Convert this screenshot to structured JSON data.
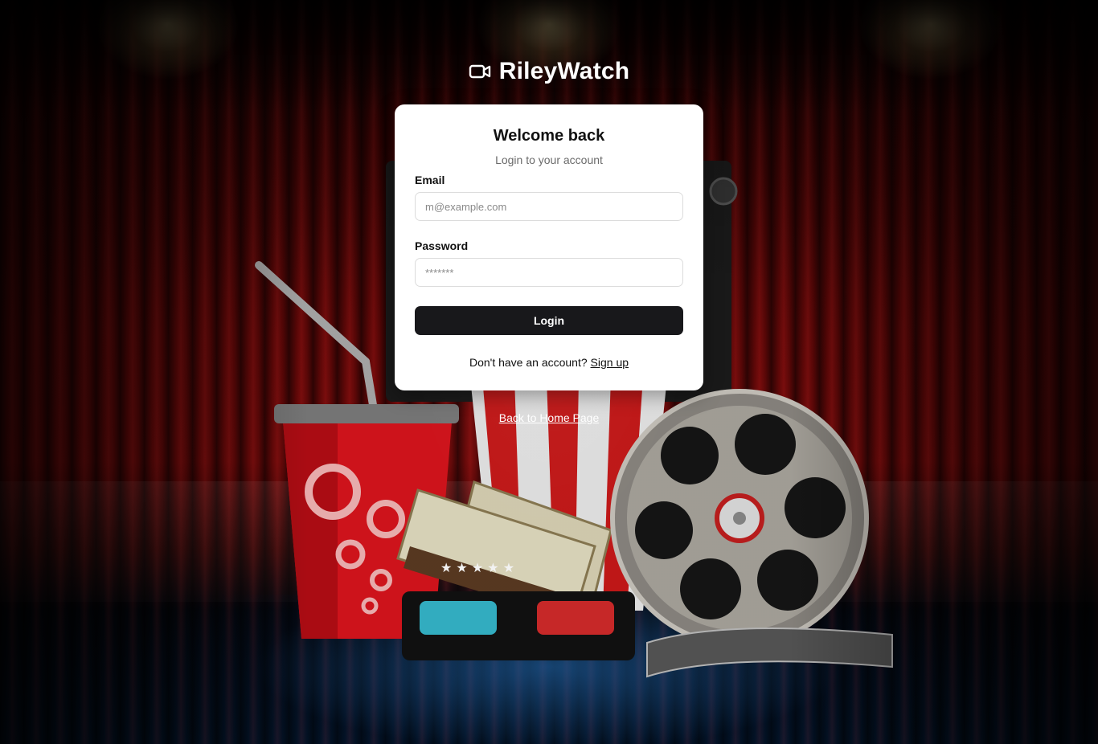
{
  "brand": {
    "title": "RileyWatch",
    "icon": "video-camera-icon"
  },
  "login_card": {
    "title": "Welcome back",
    "subtitle": "Login to your account",
    "email": {
      "label": "Email",
      "placeholder": "m@example.com",
      "value": ""
    },
    "password": {
      "label": "Password",
      "placeholder": "*******",
      "value": ""
    },
    "submit_label": "Login",
    "signup_prompt": "Don't have an account?",
    "signup_link": "Sign up"
  },
  "back_link": "Back to Home Page",
  "colors": {
    "button_bg": "#18181b",
    "card_bg": "#ffffff",
    "curtain_red": "#7a0a0a",
    "stage_blue": "#03152b"
  }
}
